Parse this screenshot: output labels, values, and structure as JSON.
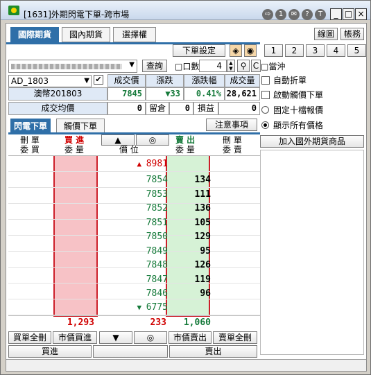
{
  "window": {
    "title": "[1631]外期閃電下單-跨市場"
  },
  "titlebar": {
    "buttons": [
      "⇨",
      "1",
      "✉",
      "?",
      "T"
    ],
    "min": "_",
    "max": "□",
    "close": "×"
  },
  "tabs": {
    "main": [
      {
        "label": "國際期貨",
        "active": true
      },
      {
        "label": "國內期貨",
        "active": false
      },
      {
        "label": "選擇權",
        "active": false
      }
    ],
    "chart_btn": "線圖",
    "account_btn": "帳務"
  },
  "toolbar": {
    "order_settings": "下單設定",
    "account_select": "",
    "query_btn": "查詢",
    "qty_check_label": "口數",
    "qty_value": "4",
    "day_trade_label": "當沖",
    "qty_buttons": [
      "1",
      "2",
      "3",
      "4",
      "5"
    ],
    "reset_btn": "C"
  },
  "contract": {
    "symbol": "AD_1803",
    "name": "澳幣201803",
    "headers": [
      "成交價",
      "漲跌",
      "漲跌幅",
      "成交量"
    ],
    "last": "7845",
    "change": "▼33",
    "pct": "0.41%",
    "volume": "28,621"
  },
  "avg": {
    "label": "成交均價",
    "avg_val": "0",
    "hold_label": "留倉",
    "hold_val": "0",
    "pl_label": "損益",
    "pl_val": "0"
  },
  "options": [
    {
      "label": "自動折單",
      "checked": false
    },
    {
      "label": "啟動觸價下單",
      "checked": false
    }
  ],
  "radios": [
    {
      "label": "固定十檔報價",
      "checked": false
    },
    {
      "label": "顯示所有價格",
      "checked": true
    }
  ],
  "add_intl": "加入國外期貨商品",
  "ladder_tabs": {
    "flash": "閃電下單",
    "touch": "觸價下單",
    "notice": "注意事項"
  },
  "ladder_header": {
    "cancel_buy": "刪 單",
    "entrust_buy": "委 買",
    "buy": "買 進",
    "buy_q": "委 量",
    "up": "▲",
    "center": "◎",
    "price": "價 位",
    "sell": "賣 出",
    "sell_q": "委 量",
    "cancel_sell": "刪 單",
    "entrust_sell": "委 賣"
  },
  "ladder": {
    "top_price": "8981",
    "bottom_price": "6775",
    "rows": [
      {
        "price": "7854",
        "ask": "134"
      },
      {
        "price": "7853",
        "ask": "111"
      },
      {
        "price": "7852",
        "ask": "136"
      },
      {
        "price": "7851",
        "ask": "105"
      },
      {
        "price": "7850",
        "ask": "129"
      },
      {
        "price": "7849",
        "ask": "95"
      },
      {
        "price": "7848",
        "ask": "126"
      },
      {
        "price": "7847",
        "ask": "119"
      },
      {
        "price": "7846",
        "ask": "96"
      }
    ]
  },
  "totals": {
    "buy": "1,293",
    "diff": "233",
    "sell": "1,060"
  },
  "bottom_btns": {
    "cancel_all_buy": "買單全刪",
    "mkt_buy": "市價買進",
    "down": "▼",
    "center": "◎",
    "mkt_sell": "市價賣出",
    "cancel_all_sell": "賣單全刪"
  },
  "action_btns": {
    "buy": "買進",
    "sell": "賣出"
  },
  "colors": {
    "tab_blue": "#2f6fa8",
    "buy_col": "#f7c2c6",
    "sell_col": "#d6f2d6",
    "price_green": "#157a3a",
    "up_red": "#d00000"
  }
}
